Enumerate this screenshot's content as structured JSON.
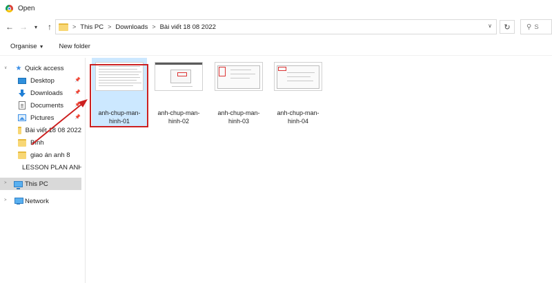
{
  "window": {
    "title": "Open",
    "app_icon": "chrome-icon"
  },
  "address_bar": {
    "crumbs": [
      "This PC",
      "Downloads",
      "Bài viết 18 08 2022"
    ],
    "separator": ">",
    "search_placeholder": "S"
  },
  "toolbar": {
    "organise_label": "Organise",
    "new_folder_label": "New folder"
  },
  "sidebar": {
    "quick_access": "Quick access",
    "items": [
      {
        "label": "Desktop",
        "icon": "desktop-icon",
        "pinned": true
      },
      {
        "label": "Downloads",
        "icon": "download-icon",
        "pinned": true
      },
      {
        "label": "Documents",
        "icon": "documents-icon",
        "pinned": true
      },
      {
        "label": "Pictures",
        "icon": "pictures-icon",
        "pinned": true
      },
      {
        "label": "Bài viết 18 08 2022",
        "icon": "folder-icon",
        "pinned": false
      },
      {
        "label": "Bình",
        "icon": "folder-icon",
        "pinned": false
      },
      {
        "label": "giao án anh 8",
        "icon": "folder-icon",
        "pinned": false
      },
      {
        "label": "LESSON PLAN ANH",
        "icon": "folder-icon",
        "pinned": false
      }
    ],
    "this_pc": "This PC",
    "network": "Network"
  },
  "files": [
    {
      "line1": "anh-chup-man-",
      "line2": "hinh-01",
      "selected": true
    },
    {
      "line1": "anh-chup-man-",
      "line2": "hinh-02",
      "selected": false
    },
    {
      "line1": "anh-chup-man-",
      "line2": "hinh-03",
      "selected": false
    },
    {
      "line1": "anh-chup-man-",
      "line2": "hinh-04",
      "selected": false
    }
  ],
  "colors": {
    "selection": "#cce8ff",
    "annotation_red": "#cc1f1f",
    "accent_blue": "#1f7fd6"
  }
}
